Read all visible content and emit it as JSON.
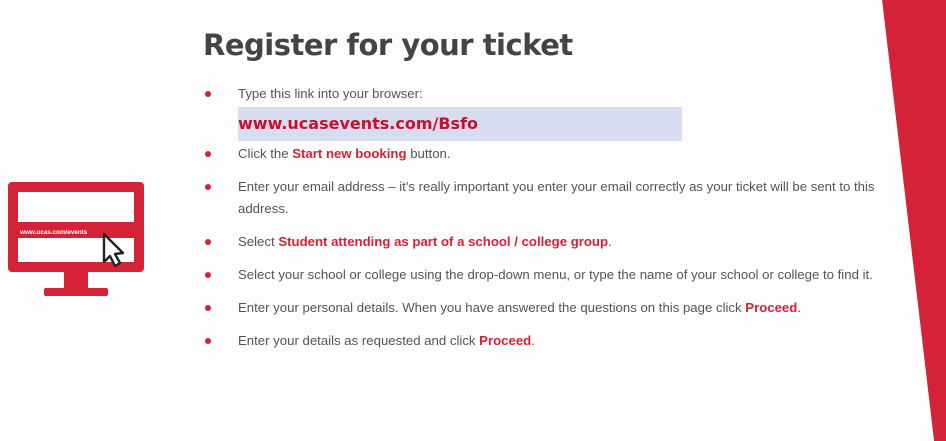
{
  "title": "Register for your ticket",
  "monitor_url": "www.ucas.com/events",
  "steps": [
    {
      "pre": "Type this link into your browser:",
      "link": "www.ucasevents.com/Bsfo"
    },
    {
      "pre": "Click the ",
      "hl": "Start new booking",
      "post": " button."
    },
    {
      "pre": "Enter your email address – it's really important you enter your email correctly as your ticket will be sent to this address."
    },
    {
      "pre": "Select ",
      "hl": "Student attending as part of a school / college group",
      "post": "."
    },
    {
      "pre": "Select your school or college using the drop-down menu, or type the name of your school or college to find it."
    },
    {
      "pre": "Enter your personal details. When you have answered the questions on this page click ",
      "hl": "Proceed",
      "post": "."
    },
    {
      "pre": "Enter your details as requested and click ",
      "hl": "Proceed",
      "post": "."
    }
  ],
  "colors": {
    "accent": "#d42236",
    "link_bg": "#d8dcf0",
    "text": "#555555",
    "title": "#444444"
  },
  "icons": {
    "monitor": "computer-monitor-icon",
    "cursor": "mouse-pointer-icon"
  }
}
